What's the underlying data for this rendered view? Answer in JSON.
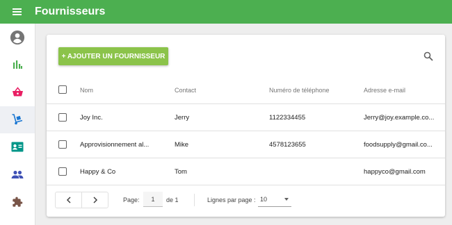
{
  "header": {
    "title": "Fournisseurs"
  },
  "sidebar": {
    "items": [
      {
        "icon": "account-circle-icon",
        "color": "#757575"
      },
      {
        "icon": "bar-chart-icon",
        "color": "#4caf50"
      },
      {
        "icon": "basket-icon",
        "color": "#e91e63"
      },
      {
        "icon": "dolly-icon",
        "color": "#1976d2",
        "active": true
      },
      {
        "icon": "contact-card-icon",
        "color": "#009688"
      },
      {
        "icon": "people-icon",
        "color": "#3f51b5"
      },
      {
        "icon": "puzzle-icon",
        "color": "#795548"
      }
    ]
  },
  "toolbar": {
    "add_label": "+ AJOUTER UN FOURNISSEUR"
  },
  "table": {
    "columns": [
      "Nom",
      "Contact",
      "Numéro de téléphone",
      "Adresse e-mail"
    ],
    "rows": [
      {
        "name": "Joy Inc.",
        "contact": "Jerry",
        "phone": "1122334455",
        "email": "Jerry@joy.example.co..."
      },
      {
        "name": "Approvisionnement al...",
        "contact": "Mike",
        "phone": "4578123655",
        "email": "foodsupply@gmail.co..."
      },
      {
        "name": "Happy & Co",
        "contact": "Tom",
        "phone": "",
        "email": "happyco@gmail.com"
      }
    ]
  },
  "pagination": {
    "page_label": "Page:",
    "page_value": "1",
    "of_label": "de 1",
    "rows_per_page_label": "Lignes par page :",
    "rows_per_page_value": "10"
  }
}
